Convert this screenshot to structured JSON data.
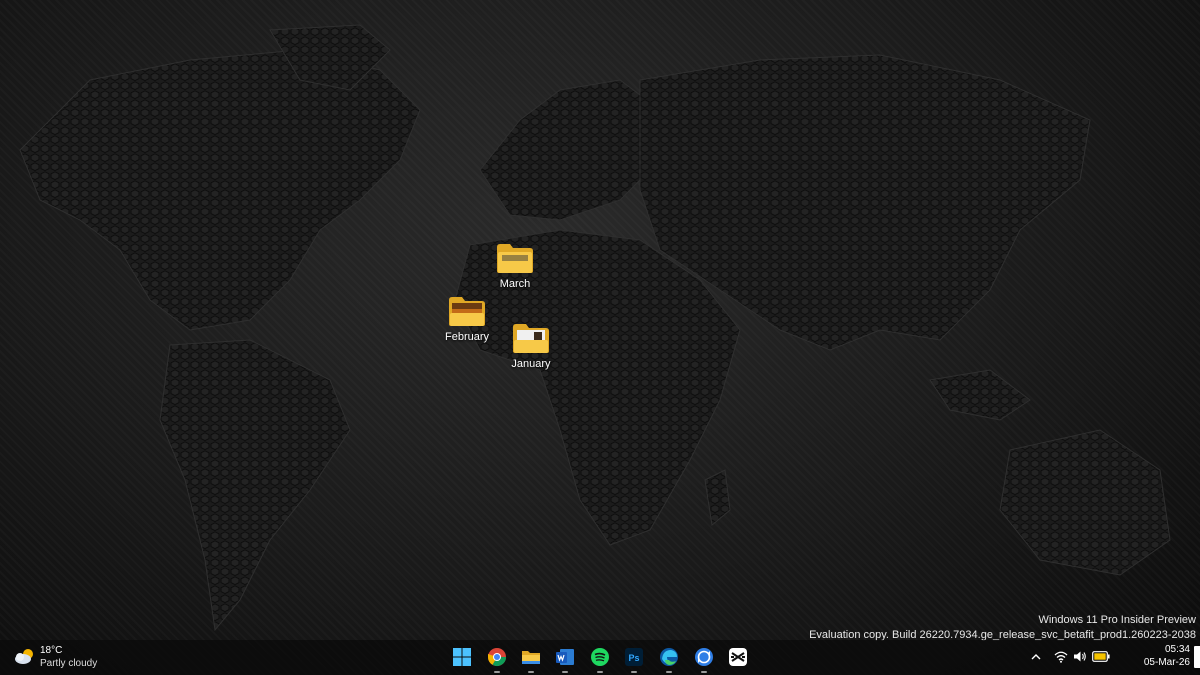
{
  "desktop": {
    "icons": [
      {
        "label": "March",
        "name": "folder-march"
      },
      {
        "label": "February",
        "name": "folder-february"
      },
      {
        "label": "January",
        "name": "folder-january"
      }
    ]
  },
  "watermark": {
    "line1": "Windows 11 Pro Insider Preview",
    "line2": "Evaluation copy. Build 26220.7934.ge_release_svc_betafit_prod1.260223-2038"
  },
  "taskbar": {
    "weather": {
      "temp": "18°C",
      "condition": "Partly cloudy",
      "icon": "partly-cloudy-icon"
    },
    "apps": [
      {
        "name": "start-button",
        "icon": "windows-logo-icon",
        "running": false
      },
      {
        "name": "chrome-app",
        "icon": "chrome-icon",
        "running": true
      },
      {
        "name": "file-explorer-app",
        "icon": "folder-icon",
        "running": true
      },
      {
        "name": "word-app",
        "icon": "word-icon",
        "running": true
      },
      {
        "name": "spotify-app",
        "icon": "spotify-icon",
        "running": true
      },
      {
        "name": "photoshop-app",
        "icon": "photoshop-icon",
        "running": true
      },
      {
        "name": "edge-app",
        "icon": "edge-icon",
        "running": true
      },
      {
        "name": "sync-app",
        "icon": "sync-icon",
        "running": true
      },
      {
        "name": "capcut-app",
        "icon": "capcut-icon",
        "running": false
      }
    ],
    "tray": {
      "icons": [
        "chevron-up-icon",
        "wifi-icon",
        "volume-icon",
        "battery-icon"
      ],
      "battery_color": "#f5c400"
    },
    "clock": {
      "time": "05:34",
      "date": "05-Mar-26"
    }
  },
  "colors": {
    "folder_yellow": "#f7c948",
    "accent_blue": "#4cc2ff"
  }
}
